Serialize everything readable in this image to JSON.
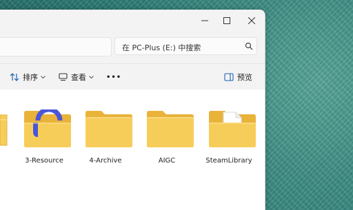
{
  "search": {
    "placeholder_text": "在 PC-Plus (E:) 中搜索"
  },
  "toolbar": {
    "sort_label": "排序",
    "view_label": "查看",
    "more_label": "•••",
    "preview_label": "预览"
  },
  "folders": [
    {
      "name": "3-Resource",
      "overlay": "resource-app-icon"
    },
    {
      "name": "4-Archive",
      "overlay": "none"
    },
    {
      "name": "AIGC",
      "overlay": "none"
    },
    {
      "name": "SteamLibrary",
      "overlay": "document"
    }
  ],
  "colors": {
    "folder_front": "#f7cd5a",
    "folder_back": "#e9b33a",
    "resource_overlay": "#4a55d8",
    "window_bg": "#f3f3f3",
    "content_bg": "#ffffff"
  }
}
